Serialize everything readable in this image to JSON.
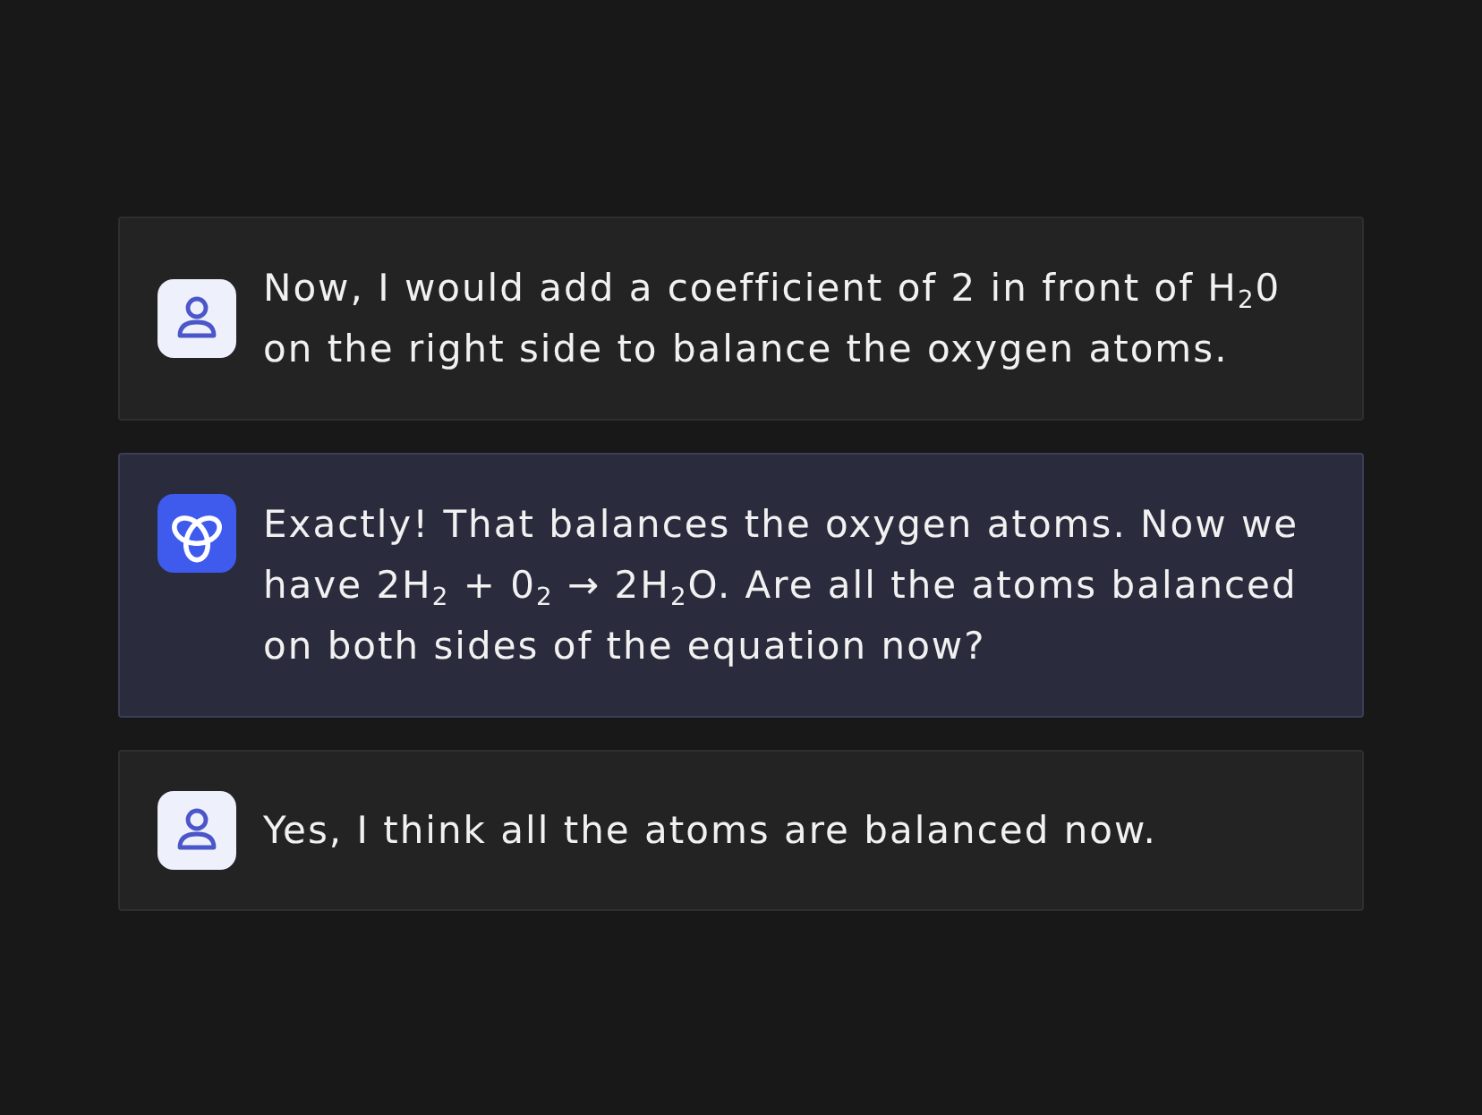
{
  "messages": [
    {
      "kind": "user",
      "text": "Now, I would add a coefficient of 2 in front of H$_{2}$0 on the right side to balance the oxygen atoms."
    },
    {
      "kind": "assistant",
      "text": "Exactly! That balances the oxygen atoms. Now we have 2H$_{2}$ + 0$_{2}$ → 2H$_{2}$O. Are all the atoms balanced on both sides of the equation now?"
    },
    {
      "kind": "user",
      "text": "Yes, I think all the atoms are balanced now."
    }
  ]
}
